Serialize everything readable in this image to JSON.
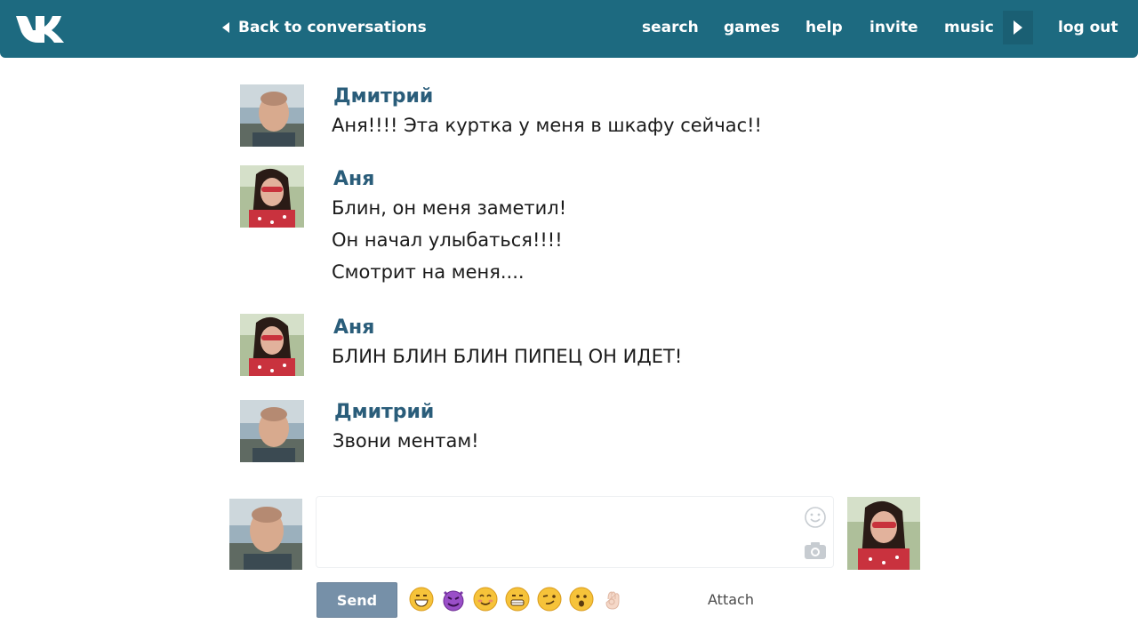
{
  "header": {
    "logo": "vk-logo",
    "back_label": "Back to conversations",
    "nav": [
      "search",
      "games",
      "help",
      "invite",
      "music"
    ],
    "logout_label": "log out"
  },
  "messages": [
    {
      "author": "Дмитрий",
      "avatar": "dmitry-avatar",
      "lines": [
        "Аня!!!! Эта куртка у меня в шкафу сейчас!!"
      ]
    },
    {
      "author": "Аня",
      "avatar": "anya-avatar",
      "lines": [
        "Блин, он меня заметил!",
        "Он начал улыбаться!!!!",
        "Смотрит на меня...."
      ]
    },
    {
      "author": "Аня",
      "avatar": "anya-avatar",
      "lines": [
        "БЛИН БЛИН БЛИН ПИПЕЦ ОН ИДЕТ!"
      ]
    },
    {
      "author": "Дмитрий",
      "avatar": "dmitry-avatar",
      "lines": [
        "Звони ментам!"
      ]
    }
  ],
  "composer": {
    "input_value": "",
    "send_label": "Send",
    "attach_label": "Attach",
    "emojis": [
      "grinning-face",
      "smiling-imp",
      "smiling-face",
      "grinning-face",
      "winking-face",
      "surprised-face",
      "ok-hand"
    ]
  },
  "colors": {
    "header_bg": "#1d6a80",
    "author_name": "#2a5d7a",
    "send_button": "#7690a8"
  }
}
